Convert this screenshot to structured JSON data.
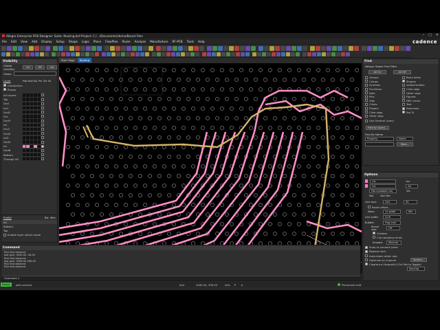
{
  "window": {
    "title": "Allegro Enterprise PCB Designer: Suite: Routing.brd  Project: C:/.../Documents/demo/Board Files",
    "logo": "cadence",
    "controls": [
      "–",
      "□",
      "×"
    ]
  },
  "menu": [
    "File",
    "Edit",
    "View",
    "Add",
    "Display",
    "Setup",
    "Shape",
    "Logic",
    "Place",
    "FlowPlan",
    "Route",
    "Analyze",
    "Manufacture",
    "RF-PCB",
    "Tools",
    "Help"
  ],
  "tabs": [
    {
      "label": "Start Page",
      "active": false
    },
    {
      "label": "Routing",
      "active": true
    }
  ],
  "visibility": {
    "title": "Visibility",
    "global_label": "Global visibility:",
    "global_buttons": [
      "On",
      "Off",
      "List"
    ],
    "views_label": "Views:",
    "layer_header": "Layer",
    "column_headers": [
      "Plan",
      "Etch",
      "Via",
      "Pin",
      "Drc",
      "All"
    ],
    "conductors": "Conductors",
    "planes": "Planes",
    "all_layers": "All Layers",
    "layers": [
      {
        "name": "Top",
        "colors": [
          "#111111",
          "#111111",
          "#111111",
          "#111111",
          "#111111"
        ],
        "all": false
      },
      {
        "name": "Gnd",
        "colors": [
          "#111111",
          "#111111",
          "#111111",
          "#111111",
          "#111111"
        ],
        "all": false
      },
      {
        "name": "Int1",
        "colors": [
          "#111111",
          "#111111",
          "#111111",
          "#111111",
          "#111111"
        ],
        "all": false
      },
      {
        "name": "Gnd2",
        "colors": [
          "#111111",
          "#111111",
          "#111111",
          "#111111",
          "#111111"
        ],
        "all": false
      },
      {
        "name": "Vcc",
        "colors": [
          "#111111",
          "#111111",
          "#111111",
          "#111111",
          "#111111"
        ],
        "all": false
      },
      {
        "name": "Gnd3",
        "colors": [
          "#111111",
          "#111111",
          "#111111",
          "#111111",
          "#111111"
        ],
        "all": false
      },
      {
        "name": "Int",
        "colors": [
          "#111111",
          "#111111",
          "#111111",
          "#111111",
          "#111111"
        ],
        "all": false
      },
      {
        "name": "Vcc2",
        "colors": [
          "#111111",
          "#111111",
          "#111111",
          "#111111",
          "#111111"
        ],
        "all": false
      },
      {
        "name": "Gnd4",
        "colors": [
          "#111111",
          "#111111",
          "#111111",
          "#111111",
          "#111111"
        ],
        "all": false
      },
      {
        "name": "Int3",
        "colors": [
          "#111111",
          "#111111",
          "#111111",
          "#111111",
          "#111111"
        ],
        "all": false
      },
      {
        "name": "Gnd5",
        "colors": [
          "#111111",
          "#111111",
          "#111111",
          "#111111",
          "#111111"
        ],
        "all": false
      },
      {
        "name": "Int",
        "colors": [
          "#ff80c0",
          "#ff80c0",
          "#111111",
          "#ff80c0",
          "#111111"
        ],
        "all": true
      },
      {
        "name": "Gnd6",
        "colors": [
          "#111111",
          "#111111",
          "#111111",
          "#111111",
          "#111111"
        ],
        "all": false
      },
      {
        "name": "Bottom",
        "colors": [
          "#111111",
          "#111111",
          "#111111",
          "#111111",
          "#111111"
        ],
        "all": false
      },
      {
        "name": "Through All",
        "colors": [
          "#111111",
          "#111111",
          "#111111",
          "#111111",
          "#111111"
        ],
        "all": false
      }
    ],
    "profile_header": "Profile",
    "profile_cols": [
      "Bot",
      "Wire"
    ],
    "profiles": [
      "All",
      "Bottom",
      "Top"
    ],
    "enable_layer_select": "Enable layer select mode"
  },
  "command": {
    "title": "Command",
    "lines": [
      "Pick first element",
      "last pick: 3200.00 -45.00",
      "Pick first element",
      "last pick: 3208.00 260.00",
      "Pick first element",
      "Pick first element"
    ],
    "prompt": "Command >"
  },
  "status": {
    "ready": "Ready",
    "mode": "add connect",
    "layer": "Int4",
    "coords": "4165.00, 306.00",
    "units": "mils",
    "placement": "Placement edit",
    "snap": "P",
    "extra": "A"
  },
  "find": {
    "title": "Find",
    "section": "Design Object Find Filter",
    "all_on": "All On",
    "all_off": "All Off",
    "left_items": [
      "Groups",
      "Comps",
      "Symbols",
      "Functions",
      "Nets",
      "Pins",
      "Vias",
      "Clines",
      "Fingers",
      "Cline segs",
      "Other segs"
    ],
    "right_items": [
      "Bond wires",
      "Shapes",
      "Voids/Cavities",
      "Cline segs",
      "Other segs",
      "Figures",
      "DRC errors",
      "Text",
      "Ratsnests",
      "Rat Ts"
    ],
    "general_query": "Use General Query",
    "find_by_query": "Find by Query...",
    "find_by_name": "Find By Name",
    "property": "Property",
    "name_option": "Name",
    "more": "More..."
  },
  "options": {
    "title": "Options",
    "layer1": "Int",
    "layer2": "Int",
    "act": "Act",
    "alt": "Alt",
    "alt_val": "All",
    "via_label": "Via",
    "net_value": "(No available via)",
    "net": "Net",
    "null_net": "Null Net",
    "line_lock_label": "Line lock:",
    "line_lock_type": "Line",
    "line_lock_angle": "45",
    "route_offset": "Route offset:",
    "miter_label": "Miter:",
    "miter_val": "1x width",
    "miter_min": "Min",
    "line_width_label": "Line width:",
    "line_width": "4.00",
    "bubble_label": "Bubble:",
    "bubble_val": "Hug only",
    "shove_vias_label": "Shove vias:",
    "shove_vias_val": "Off",
    "gridless": "Gridless",
    "clip": "Clip dangling clines",
    "smooth_label": "Smooth:",
    "smooth_val": "Minimal",
    "snap_connect": "Snap to connect point",
    "replace_etch": "Replace etch",
    "auto_blank": "Auto-blank other rats",
    "optimize": "Optimize on channel",
    "options_btn": "Options...",
    "clearance": "Clearance Viewpoint (Ctrl-Tab to Toggle)",
    "spacing": "Spacing"
  }
}
